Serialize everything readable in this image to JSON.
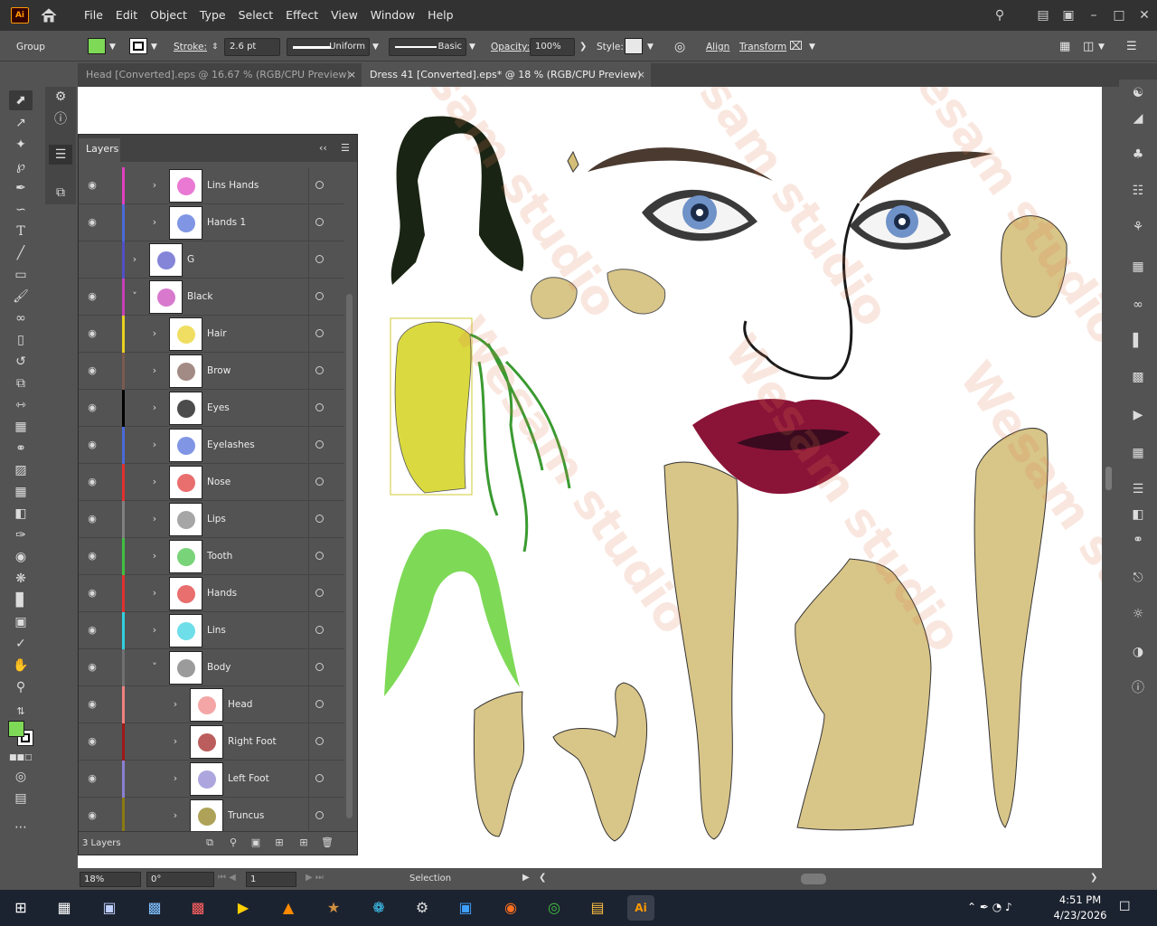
{
  "app": {
    "logo": "Ai"
  },
  "menu": [
    "File",
    "Edit",
    "Object",
    "Type",
    "Select",
    "Effect",
    "View",
    "Window",
    "Help"
  ],
  "control": {
    "selection_type": "Group",
    "fill_color": "#7ed957",
    "stroke_label": "Stroke:",
    "stroke_weight": "2.6 pt",
    "profile_uniform": "Uniform",
    "brush_basic": "Basic",
    "opacity_label": "Opacity:",
    "opacity_value": "100%",
    "style_label": "Style:",
    "align_label": "Align",
    "transform_label": "Transform"
  },
  "tabs": [
    {
      "label": "Head [Converted].eps @ 16.67 % (RGB/CPU Preview)",
      "close": "×",
      "active": false
    },
    {
      "label": "Dress 41 [Converted].eps* @ 18 % (RGB/CPU Preview)",
      "close": "×",
      "active": true
    }
  ],
  "layers_panel": {
    "title": "Layers",
    "footer_count": "3 Layers",
    "rows": [
      {
        "name": "Lins Hands",
        "color": "#e040c0"
      },
      {
        "name": "Hands 1",
        "color": "#4a6ad8"
      },
      {
        "name": "G",
        "color": "#5050c8"
      },
      {
        "name": "Black",
        "color": "#c840b8"
      },
      {
        "name": "Hair",
        "color": "#e8d020"
      },
      {
        "name": "Brow",
        "color": "#7a5a50"
      },
      {
        "name": "Eyes",
        "color": "#000000"
      },
      {
        "name": "Eyelashes",
        "color": "#4a6ad8"
      },
      {
        "name": "Nose",
        "color": "#e03030"
      },
      {
        "name": "Lips",
        "color": "#808080"
      },
      {
        "name": "Tooth",
        "color": "#40c040"
      },
      {
        "name": "Hands",
        "color": "#e03030"
      },
      {
        "name": "Lins",
        "color": "#30d0e0"
      },
      {
        "name": "Body",
        "color": "#707070"
      },
      {
        "name": "Head",
        "color": "#f08080"
      },
      {
        "name": "Right Foot",
        "color": "#a01818"
      },
      {
        "name": "Left Foot",
        "color": "#8a80d0"
      },
      {
        "name": "Truncus",
        "color": "#8a7a10"
      }
    ]
  },
  "status": {
    "zoom": "18%",
    "rotation": "0°",
    "artboard": "1",
    "tool": "Selection"
  },
  "taskbar": {
    "time": "4:51 PM",
    "date": "4/23/2026"
  },
  "watermark": "Wesam studio"
}
